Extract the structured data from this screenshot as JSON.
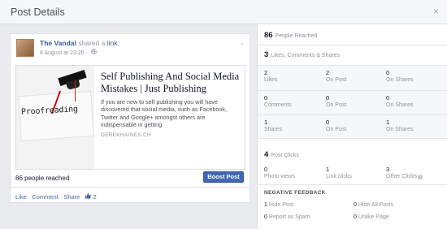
{
  "dialog": {
    "title": "Post Details",
    "close_glyph": "×"
  },
  "post": {
    "author": "The Vandal",
    "shared_text": "shared a",
    "link_word": "link.",
    "timestamp": "8 August at 23:26",
    "privacy_glyph": "·",
    "privacy_icon": "globe-icon",
    "menu_glyph": "⌄",
    "attachment": {
      "image_word": "Proofreading",
      "title": "Self Publishing And Social Media Mistakes | Just Publishing",
      "description": "If you are new to self publishing you will have discovered that social media, such as Facebook, Twitter and Google+ amongst others are indispensable in getting",
      "domain": "DEREKHAINES.CH"
    },
    "reach_text": "86 people reached",
    "boost_label": "Boost Post",
    "actions": {
      "like": "Like",
      "comment": "Comment",
      "share": "Share",
      "sep": "·",
      "like_count": "2",
      "like_icon": "thumbs-up-icon",
      "like_glyph": "👍"
    }
  },
  "stats": {
    "people_reached": {
      "value": "86",
      "label": "People Reached"
    },
    "engagement": {
      "value": "3",
      "label": "Likes, Comments & Shares"
    },
    "rows": [
      [
        {
          "value": "2",
          "label": "Likes"
        },
        {
          "value": "2",
          "label": "On Post"
        },
        {
          "value": "0",
          "label": "On Shares"
        }
      ],
      [
        {
          "value": "0",
          "label": "Comments"
        },
        {
          "value": "0",
          "label": "On Post"
        },
        {
          "value": "0",
          "label": "On Shares"
        }
      ],
      [
        {
          "value": "1",
          "label": "Shares"
        },
        {
          "value": "0",
          "label": "On Post"
        },
        {
          "value": "1",
          "label": "On Shares"
        }
      ]
    ],
    "post_clicks": {
      "value": "4",
      "label": "Post Clicks"
    },
    "clicks": [
      {
        "value": "0",
        "label": "Photo views"
      },
      {
        "value": "1",
        "label": "Link clicks"
      },
      {
        "value": "3",
        "label": "Other Clicks"
      }
    ],
    "info_glyph": "i",
    "negative": {
      "title": "NEGATIVE FEEDBACK",
      "items": [
        {
          "value": "1",
          "label": "Hide Post"
        },
        {
          "value": "0",
          "label": "Hide All Posts"
        },
        {
          "value": "0",
          "label": "Report as Spam"
        },
        {
          "value": "0",
          "label": "Unlike Page"
        }
      ]
    }
  }
}
